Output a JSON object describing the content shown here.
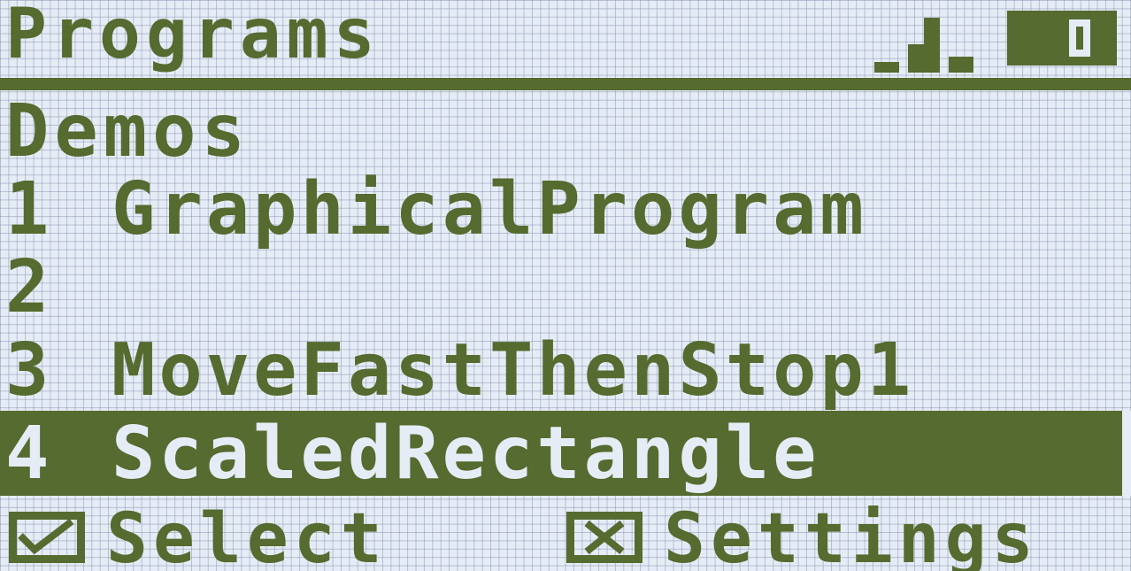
{
  "header": {
    "title": "Programs",
    "battery_icon": "battery-icon",
    "signal_icon": "signal-strength-icon"
  },
  "group": {
    "label": "Demos"
  },
  "programs": [
    {
      "number": "1",
      "name": "GraphicalProgram",
      "selected": false
    },
    {
      "number": "2",
      "name": "",
      "selected": false
    },
    {
      "number": "3",
      "name": "MoveFastThenStop1",
      "selected": false
    },
    {
      "number": "4",
      "name": "ScaledRectangle",
      "selected": true
    }
  ],
  "softkeys": {
    "left": {
      "icon": "checkmark-icon",
      "label": "Select"
    },
    "right": {
      "icon": "cross-icon",
      "label": "Settings"
    }
  },
  "colors": {
    "lcd_background": "#e6ecf6",
    "lcd_foreground": "#556b2f"
  }
}
